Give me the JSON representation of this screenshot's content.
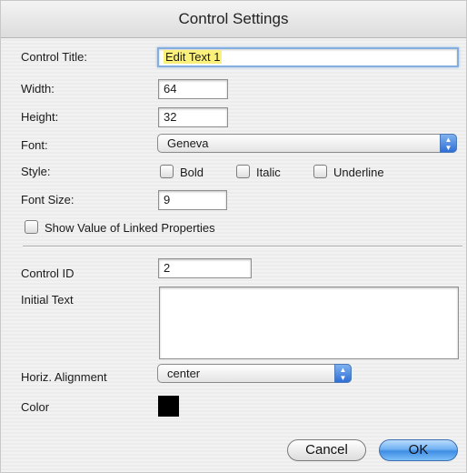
{
  "window": {
    "title": "Control Settings"
  },
  "fields": {
    "control_title": {
      "label": "Control Title:",
      "value": "Edit Text 1"
    },
    "width": {
      "label": "Width:",
      "value": "64"
    },
    "height": {
      "label": "Height:",
      "value": "32"
    },
    "font": {
      "label": "Font:",
      "value": "Geneva"
    },
    "style": {
      "label": "Style:",
      "options": [
        {
          "label": "Bold",
          "checked": false
        },
        {
          "label": "Italic",
          "checked": false
        },
        {
          "label": "Underline",
          "checked": false
        }
      ]
    },
    "font_size": {
      "label": "Font Size:",
      "value": "9"
    },
    "show_linked": {
      "label": "Show Value of Linked Properties",
      "checked": false
    },
    "control_id": {
      "label": "Control ID",
      "value": "2"
    },
    "initial_text": {
      "label": "Initial Text",
      "value": ""
    },
    "horiz_alignment": {
      "label": "Horiz. Alignment",
      "value": "center"
    },
    "color": {
      "label": "Color",
      "value": "#000000"
    }
  },
  "buttons": {
    "cancel": "Cancel",
    "ok": "OK"
  },
  "icons": {
    "popup_arrows": "up-down-arrows-icon"
  },
  "colors": {
    "highlight": "#fbf17a",
    "focus_ring": "#84aee0",
    "default_button": "#3f8ce4"
  }
}
